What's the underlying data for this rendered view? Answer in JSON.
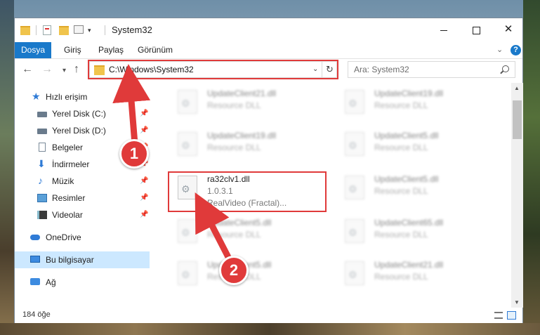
{
  "window": {
    "title": "System32"
  },
  "ribbon": {
    "tabs": [
      "Dosya",
      "Giriş",
      "Paylaş",
      "Görünüm"
    ]
  },
  "address": {
    "path": "C:\\Windows\\System32",
    "search_placeholder": "Ara: System32"
  },
  "sidebar": {
    "items": [
      {
        "label": "Hızlı erişim",
        "icon": "star-icon"
      },
      {
        "label": "Yerel Disk (C:)",
        "icon": "drive-icon",
        "pinned": true
      },
      {
        "label": "Yerel Disk (D:)",
        "icon": "drive-icon",
        "pinned": true
      },
      {
        "label": "Belgeler",
        "icon": "documents-icon",
        "pinned": true
      },
      {
        "label": "İndirmeler",
        "icon": "downloads-icon",
        "pinned": true
      },
      {
        "label": "Müzik",
        "icon": "music-icon",
        "pinned": true
      },
      {
        "label": "Resimler",
        "icon": "pictures-icon",
        "pinned": true
      },
      {
        "label": "Videolar",
        "icon": "videos-icon",
        "pinned": true
      },
      {
        "label": "OneDrive",
        "icon": "onedrive-icon"
      },
      {
        "label": "Bu bilgisayar",
        "icon": "this-pc-icon",
        "selected": true
      },
      {
        "label": "Ağ",
        "icon": "network-icon"
      }
    ]
  },
  "files": [
    {
      "name": "UpdateClient21.dll",
      "desc": "Resource DLL"
    },
    {
      "name": "UpdateClient19.dll",
      "desc": "Resource DLL"
    },
    {
      "name": "UpdateClient19.dll",
      "desc": "Resource DLL"
    },
    {
      "name": "UpdateClient5.dll",
      "desc": "Resource DLL"
    },
    {
      "name": "ra32clv1.dll",
      "version": "1.0.3.1",
      "desc": "RealVideo (Fractal)..."
    },
    {
      "name": "UpdateClient5.dll",
      "desc": "Resource DLL"
    },
    {
      "name": "UpdateClient5.dll",
      "desc": "Resource DLL"
    },
    {
      "name": "UpdateClient65.dll",
      "desc": "Resource DLL"
    },
    {
      "name": "UpdateClient5.dll",
      "desc": "Resource DLL"
    },
    {
      "name": "UpdateClient21.dll",
      "desc": "Resource DLL"
    }
  ],
  "status": {
    "item_count": "184 öğe"
  },
  "annotations": {
    "step1": "1",
    "step2": "2",
    "color": "#e03a3a"
  }
}
